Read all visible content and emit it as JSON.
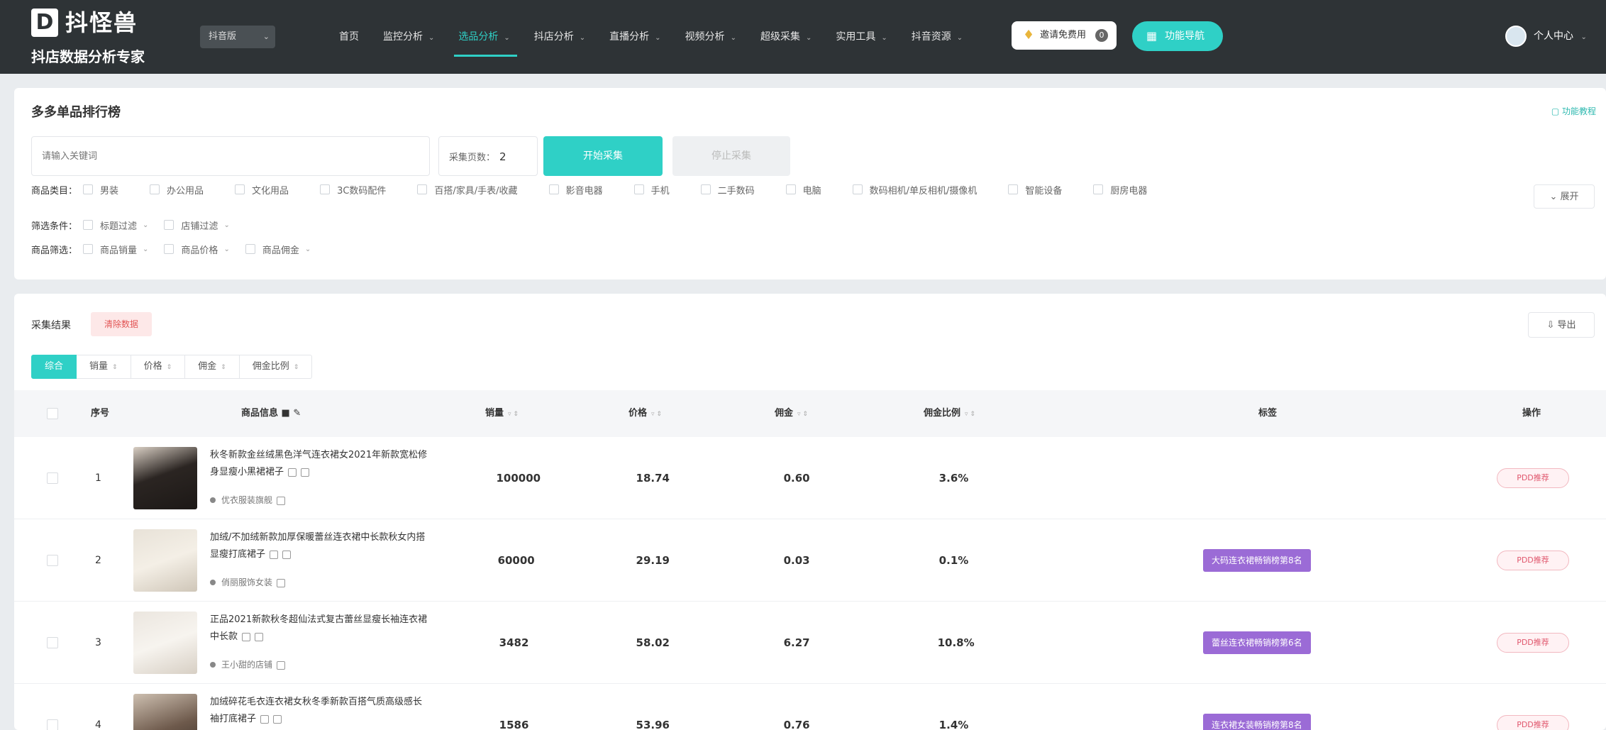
{
  "header": {
    "logo_mark": "D",
    "logo_name": "抖怪兽",
    "logo_sub": "抖店数据分析专家",
    "version": "抖音版",
    "nav": [
      {
        "label": "首页",
        "active": false,
        "dropdown": false
      },
      {
        "label": "监控分析",
        "active": false,
        "dropdown": true
      },
      {
        "label": "选品分析",
        "active": true,
        "dropdown": true
      },
      {
        "label": "抖店分析",
        "active": false,
        "dropdown": true
      },
      {
        "label": "直播分析",
        "active": false,
        "dropdown": true
      },
      {
        "label": "视频分析",
        "active": false,
        "dropdown": true
      },
      {
        "label": "超级采集",
        "active": false,
        "dropdown": true
      },
      {
        "label": "实用工具",
        "active": false,
        "dropdown": true
      },
      {
        "label": "抖音资源",
        "active": false,
        "dropdown": true
      }
    ],
    "invite_label": "邀请免费用",
    "invite_badge": "0",
    "feature_label": "功能导航",
    "user_label": "个人中心"
  },
  "filter_panel": {
    "title": "多多单品排行榜",
    "tutorial_link": "功能教程",
    "keyword_placeholder": "请输入关键词",
    "pages_label": "采集页数：",
    "pages_value": "2",
    "start_label": "开始采集",
    "stop_label": "停止采集",
    "category_label": "商品类目：",
    "categories": [
      "男装",
      "办公用品",
      "文化用品",
      "3C数码配件",
      "百搭/家具/手表/收藏",
      "影音电器",
      "手机",
      "二手数码",
      "电脑",
      "数码相机/单反相机/摄像机",
      "智能设备",
      "厨房电器"
    ],
    "expand_label": "展开",
    "filter_label": "筛选条件：",
    "filters": [
      "标题过滤",
      "店铺过滤"
    ],
    "sort_filter_label": "商品筛选：",
    "sort_filters": [
      "商品销量",
      "商品价格",
      "商品佣金"
    ]
  },
  "results_panel": {
    "title": "采集结果",
    "clear_label": "清除数据",
    "export_label": "导出",
    "sort_tabs": [
      {
        "label": "综合",
        "active": true
      },
      {
        "label": "销量",
        "active": false
      },
      {
        "label": "价格",
        "active": false
      },
      {
        "label": "佣金",
        "active": false
      },
      {
        "label": "佣金比例",
        "active": false
      }
    ],
    "columns": {
      "index": "序号",
      "product": "商品信息",
      "sales": "销量",
      "price": "价格",
      "commission": "佣金",
      "rate": "佣金比例",
      "tags": "标签",
      "action": "操作"
    },
    "rows": [
      {
        "index": "1",
        "title": "秋冬新款金丝绒黑色洋气连衣裙女2021年新款宽松修身显瘦小黑裙裙子",
        "shop": "优衣服装旗舰",
        "sales": "100000",
        "price": "18.74",
        "commission": "0.60",
        "rate": "3.6%",
        "tag": "",
        "action": "PDD推荐"
      },
      {
        "index": "2",
        "title": "加绒/不加绒新款加厚保暖蕾丝连衣裙中长款秋女内搭显瘦打底裙子",
        "shop": "俏丽服饰女装",
        "sales": "60000",
        "price": "29.19",
        "commission": "0.03",
        "rate": "0.1%",
        "tag": "大码连衣裙畅销榜第8名",
        "action": "PDD推荐"
      },
      {
        "index": "3",
        "title": "正品2021新款秋冬超仙法式复古蕾丝显瘦长袖连衣裙中长款",
        "shop": "王小甜的店铺",
        "sales": "3482",
        "price": "58.02",
        "commission": "6.27",
        "rate": "10.8%",
        "tag": "蕾丝连衣裙畅销榜第6名",
        "action": "PDD推荐"
      },
      {
        "index": "4",
        "title": "加绒碎花毛衣连衣裙女秋冬季新款百搭气质高级感长袖打底裙子",
        "shop": "",
        "sales": "1586",
        "price": "53.96",
        "commission": "0.76",
        "rate": "1.4%",
        "tag": "连衣裙女装畅销榜第8名",
        "action": "PDD推荐"
      }
    ]
  },
  "colors": {
    "header_bg": "#2e3336",
    "accent": "#2fd0c6",
    "rank_tag": "#9b6bd6",
    "pdd_btn": "#e0576d"
  }
}
